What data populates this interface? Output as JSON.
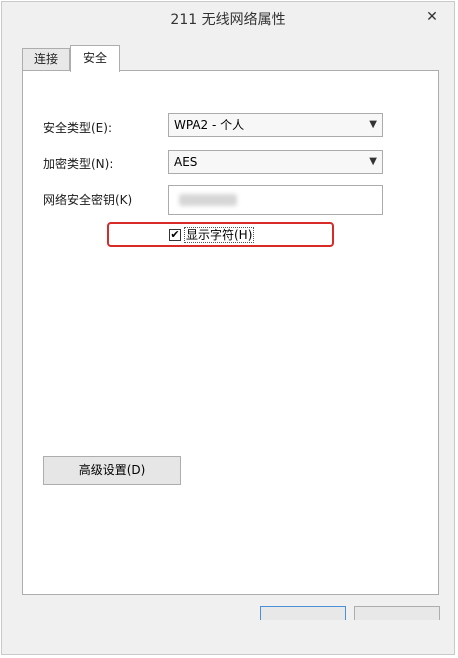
{
  "window": {
    "title": "211 无线网络属性",
    "close_glyph": "✕"
  },
  "tabs": [
    {
      "label": "连接"
    },
    {
      "label": "安全"
    }
  ],
  "security": {
    "type_label": "安全类型(E):",
    "type_value": "WPA2 - 个人",
    "encryption_label": "加密类型(N):",
    "encryption_value": "AES",
    "key_label": "网络安全密钥(K)",
    "show_chars_label": "显示字符(H)",
    "show_chars_checked": "✔",
    "advanced_button": "高级设置(D)"
  },
  "icons": {
    "dropdown": "chevron-down-icon",
    "check": "checkmark-icon",
    "close": "close-icon"
  },
  "colors": {
    "highlight": "#d92a2a"
  }
}
